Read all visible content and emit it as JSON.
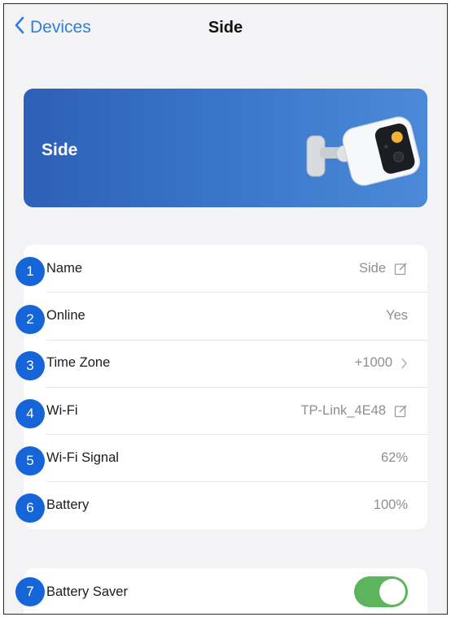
{
  "nav": {
    "back_label": "Devices",
    "title": "Side"
  },
  "hero": {
    "title": "Side"
  },
  "info_rows": [
    {
      "badge": "1",
      "label": "Name",
      "value": "Side",
      "trailing": "edit-icon"
    },
    {
      "badge": "2",
      "label": "Online",
      "value": "Yes",
      "trailing": null
    },
    {
      "badge": "3",
      "label": "Time Zone",
      "value": "+1000",
      "trailing": "chevron-right-icon"
    },
    {
      "badge": "4",
      "label": "Wi-Fi",
      "value": "TP-Link_4E48",
      "trailing": "edit-icon"
    },
    {
      "badge": "5",
      "label": "Wi-Fi Signal",
      "value": "62%",
      "trailing": null
    },
    {
      "badge": "6",
      "label": "Battery",
      "value": "100%",
      "trailing": null
    }
  ],
  "battery_saver": {
    "badge": "7",
    "label": "Battery Saver",
    "enabled": true
  },
  "colors": {
    "accent": "#2f7de1",
    "hero_blue": "#2d60b6",
    "badge_blue": "#1565d8",
    "toggle_on": "#5cb45c"
  }
}
